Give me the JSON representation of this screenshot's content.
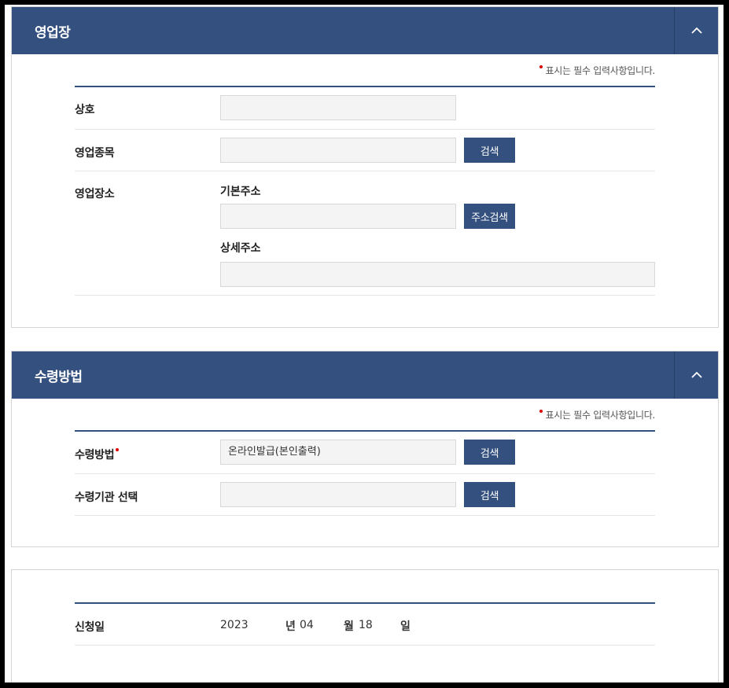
{
  "business": {
    "title": "영업장",
    "required_note": "표시는 필수 입력사항입니다.",
    "trade_name_label": "상호",
    "trade_name_value": "",
    "business_type_label": "영업종목",
    "business_type_value": "",
    "search_label": "검색",
    "location_label": "영업장소",
    "basic_address_label": "기본주소",
    "basic_address_value": "",
    "address_search_label": "주소검색",
    "detail_address_label": "상세주소",
    "detail_address_value": ""
  },
  "receipt": {
    "title": "수령방법",
    "required_note": "표시는 필수 입력사항입니다.",
    "method_label": "수령방법",
    "method_value": "온라인발급(본인출력)",
    "search_label": "검색",
    "agency_label": "수령기관 선택",
    "agency_value": ""
  },
  "application": {
    "date_label": "신청일",
    "year": "2023",
    "year_unit": "년",
    "month": "04",
    "month_unit": "월",
    "day": "18",
    "day_unit": "일"
  },
  "colors": {
    "header_bg": "#33507f",
    "required_dot": "#e10000"
  }
}
